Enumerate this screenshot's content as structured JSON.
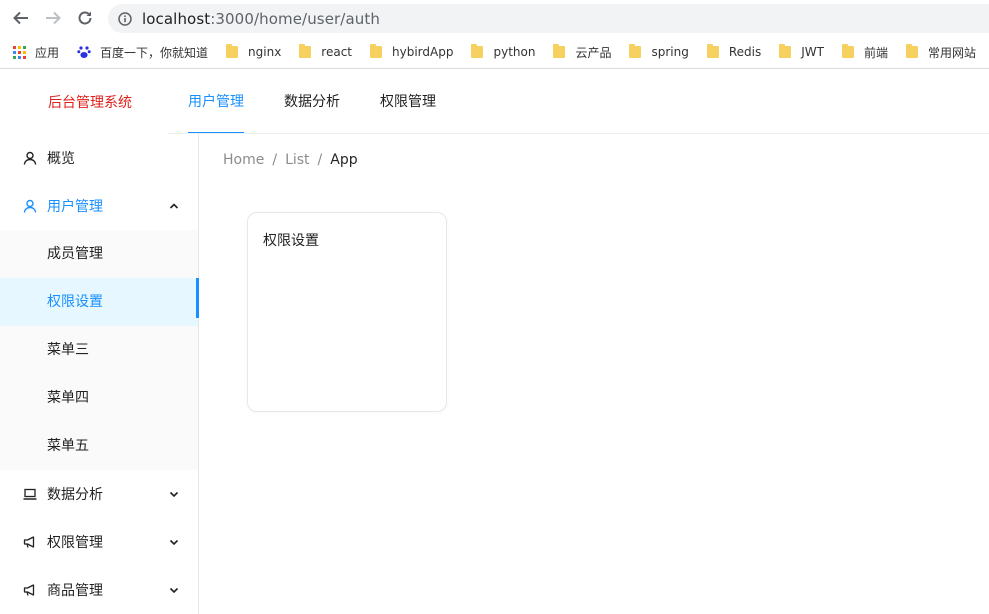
{
  "browser": {
    "url_host": "localhost",
    "url_path": ":3000/home/user/auth",
    "bookmarks": [
      {
        "label": "应用",
        "type": "apps"
      },
      {
        "label": "百度一下，你就知道",
        "type": "baidu"
      },
      {
        "label": "nginx",
        "type": "folder"
      },
      {
        "label": "react",
        "type": "folder"
      },
      {
        "label": "hybirdApp",
        "type": "folder"
      },
      {
        "label": "python",
        "type": "folder"
      },
      {
        "label": "云产品",
        "type": "folder"
      },
      {
        "label": "spring",
        "type": "folder"
      },
      {
        "label": "Redis",
        "type": "folder"
      },
      {
        "label": "JWT",
        "type": "folder"
      },
      {
        "label": "前端",
        "type": "folder"
      },
      {
        "label": "常用网站",
        "type": "folder"
      }
    ]
  },
  "header": {
    "logo": "后台管理系统",
    "nav": [
      {
        "label": "用户管理",
        "active": true
      },
      {
        "label": "数据分析",
        "active": false
      },
      {
        "label": "权限管理",
        "active": false
      }
    ]
  },
  "sidebar": {
    "items": [
      {
        "label": "概览",
        "icon": "user-icon"
      },
      {
        "label": "用户管理",
        "icon": "user-icon",
        "open": true,
        "children": [
          {
            "label": "成员管理",
            "selected": false
          },
          {
            "label": "权限设置",
            "selected": true
          },
          {
            "label": "菜单三",
            "selected": false
          },
          {
            "label": "菜单四",
            "selected": false
          },
          {
            "label": "菜单五",
            "selected": false
          }
        ]
      },
      {
        "label": "数据分析",
        "icon": "laptop-icon"
      },
      {
        "label": "权限管理",
        "icon": "notification-icon"
      },
      {
        "label": "商品管理",
        "icon": "notification-icon"
      }
    ]
  },
  "breadcrumb": [
    "Home",
    "List",
    "App"
  ],
  "card": {
    "text": "权限设置"
  },
  "colors": {
    "accent": "#1890ff",
    "logo": "#e0201b",
    "selected_bg": "#e6f7ff"
  }
}
